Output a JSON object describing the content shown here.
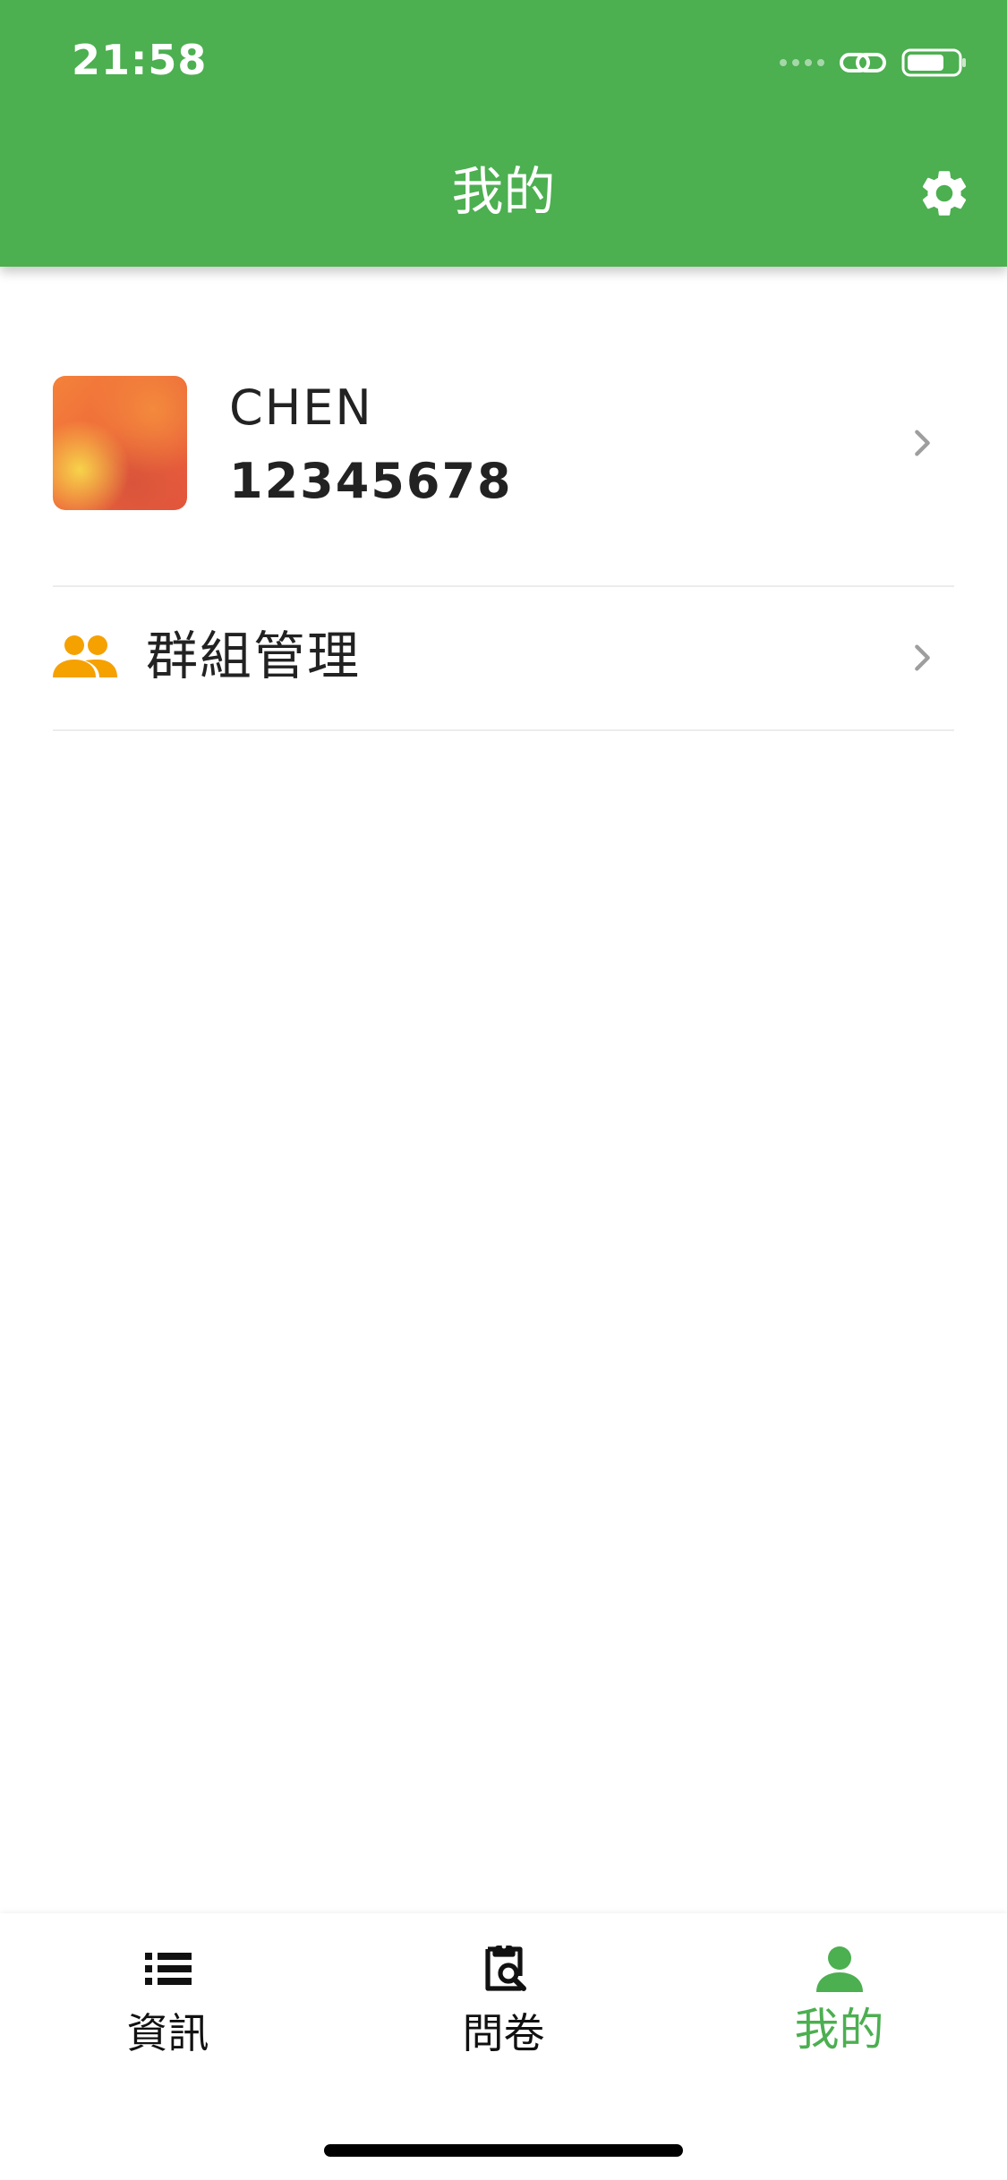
{
  "status_bar": {
    "time": "21:58"
  },
  "header": {
    "title": "我的",
    "settings_icon": "gear-icon",
    "background_color": "#4caf50"
  },
  "profile": {
    "name": "CHEN",
    "id": "12345678"
  },
  "menu": {
    "items": [
      {
        "label": "群組管理",
        "icon": "group-icon",
        "icon_color": "#f5a100"
      }
    ]
  },
  "tabs": [
    {
      "label": "資訊",
      "icon": "list-icon",
      "active": false
    },
    {
      "label": "問卷",
      "icon": "clipboard-search-icon",
      "active": false
    },
    {
      "label": "我的",
      "icon": "person-icon",
      "active": true
    }
  ],
  "colors": {
    "accent": "#4caf50",
    "text": "#222222",
    "chevron": "#9e9e9e",
    "divider": "#ececec"
  }
}
